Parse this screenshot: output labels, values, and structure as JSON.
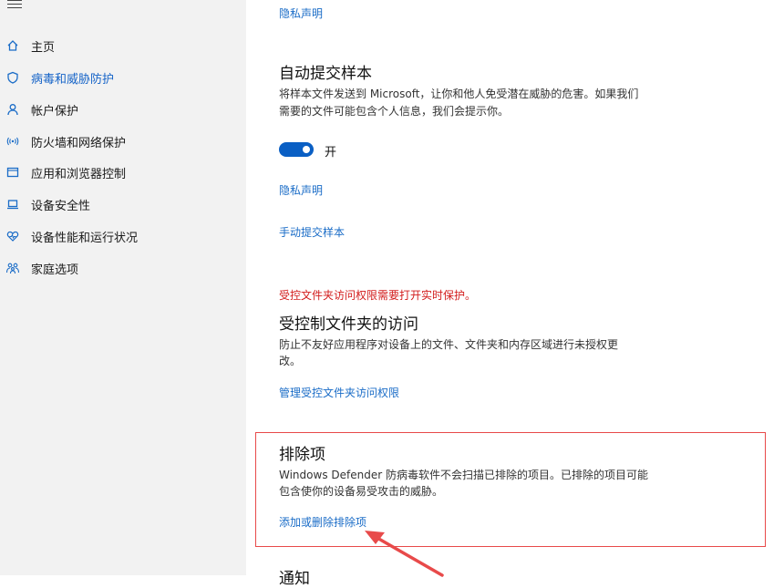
{
  "sidebar": {
    "items": [
      {
        "label": "主页",
        "icon": "home-icon"
      },
      {
        "label": "病毒和威胁防护",
        "icon": "shield-icon",
        "active": true
      },
      {
        "label": "帐户保护",
        "icon": "person-icon"
      },
      {
        "label": "防火墙和网络保护",
        "icon": "wifi-antenna-icon"
      },
      {
        "label": "应用和浏览器控制",
        "icon": "browser-window-icon"
      },
      {
        "label": "设备安全性",
        "icon": "laptop-icon"
      },
      {
        "label": "设备性能和运行状况",
        "icon": "heart-icon"
      },
      {
        "label": "家庭选项",
        "icon": "family-icon"
      }
    ]
  },
  "main": {
    "privacy_link_top": "隐私声明",
    "auto_submit": {
      "title": "自动提交样本",
      "description_line1": "将样本文件发送到 Microsoft，让你和他人免受潜在威胁的危害。如果我们",
      "description_line2": "需要的文件可能包含个人信息，我们会提示你。",
      "toggle_label": "开",
      "toggle_on": true,
      "privacy_link": "隐私声明",
      "manual_submit_link": "手动提交样本"
    },
    "controlled_folder": {
      "warning": "受控文件夹访问权限需要打开实时保护。",
      "title": "受控制文件夹的访问",
      "description_line1": "防止不友好应用程序对设备上的文件、文件夹和内存区域进行未授权更",
      "description_line2": "改。",
      "manage_link": "管理受控文件夹访问权限"
    },
    "exclusions": {
      "title": "排除项",
      "description_line1": "Windows Defender 防病毒软件不会扫描已排除的项目。已排除的项目可能",
      "description_line2": "包含使你的设备易受攻击的威胁。",
      "add_remove_link": "添加或删除排除项"
    },
    "notifications_title": "通知"
  },
  "colors": {
    "accent": "#1a6cc7",
    "warning": "#d21c1c",
    "annotation": "#e84a4a",
    "sidebar_bg": "#f2f2f2"
  }
}
